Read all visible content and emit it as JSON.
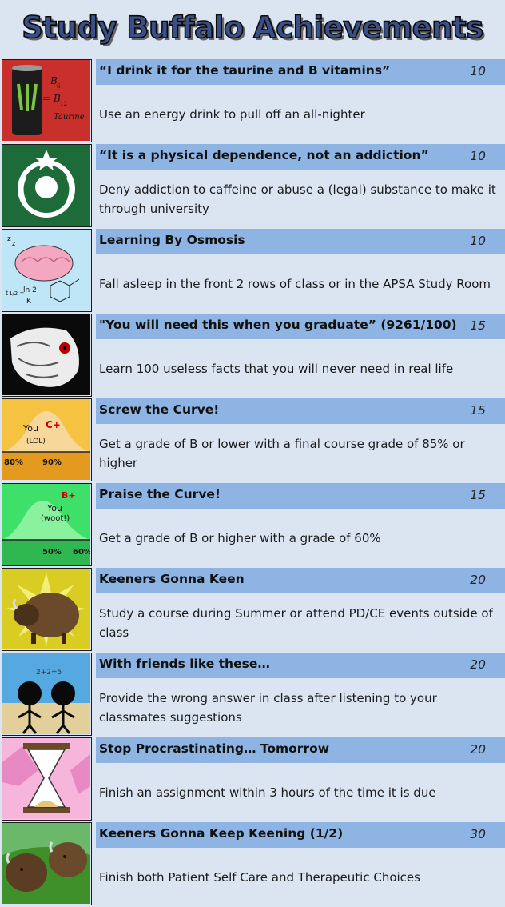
{
  "title": "Study Buffalo Achievements",
  "achievements": [
    {
      "name": "“I drink it for the taurine and B vitamins”",
      "points": "10",
      "description": "Use an energy drink to pull off an all-nighter",
      "icon": "energy-drink-icon"
    },
    {
      "name": "“It is a physical dependence, not an addiction”",
      "points": "10",
      "description": "Deny addiction to caffeine or abuse a (legal) substance to make it through university",
      "icon": "coffee-logo-icon"
    },
    {
      "name": "Learning By Osmosis",
      "points": "10",
      "description": "Fall asleep in the front 2 rows of class or in the APSA Study Room",
      "icon": "sleeping-brain-icon"
    },
    {
      "name": "\"You will need this when you graduate” (9261/100)",
      "points": "15",
      "description": "Learn 100 useless facts that you will never need in real life",
      "icon": "rage-face-icon"
    },
    {
      "name": "Screw the Curve!",
      "points": "15",
      "description": "Get a grade of B or lower with a final course grade of 85% or higher",
      "icon": "bell-curve-low-icon"
    },
    {
      "name": "Praise the Curve!",
      "points": "15",
      "description": "Get a grade of B or higher with a grade of 60%",
      "icon": "bell-curve-high-icon"
    },
    {
      "name": "Keeners Gonna Keen",
      "points": "20",
      "description": "Study a course during Summer or attend PD/CE events outside of class",
      "icon": "buffalo-icon"
    },
    {
      "name": "With friends like these…",
      "points": "20",
      "description": "Provide the wrong answer in class after listening to your classmates suggestions",
      "icon": "stick-figures-icon"
    },
    {
      "name": "Stop Procrastinating… Tomorrow",
      "points": "20",
      "description": "Finish an assignment within 3 hours of the time it is due",
      "icon": "hourglass-icon"
    },
    {
      "name": "Keeners Gonna Keep Keening (1/2)",
      "points": "30",
      "description": "Finish both Patient Self Care and Therapeutic Choices",
      "icon": "two-buffalo-icon"
    }
  ],
  "icon_text": {
    "energy_drink": [
      "B",
      "6",
      "= B",
      "12",
      "Taurine"
    ],
    "osmosis": [
      "z",
      "z",
      "ln 2",
      "K",
      "t",
      "1/2 ="
    ],
    "curve_low": [
      "You",
      "C+",
      "(LOL)",
      "80%",
      "90%"
    ],
    "curve_high": [
      "B+",
      "You",
      "(woot!)",
      "50%",
      "60%"
    ],
    "friends": [
      "2+2=5"
    ]
  },
  "colors": {
    "page_background": "#dbe5f1",
    "title_bar": "#8eb4e3",
    "title_fill": "#3a4f86"
  }
}
